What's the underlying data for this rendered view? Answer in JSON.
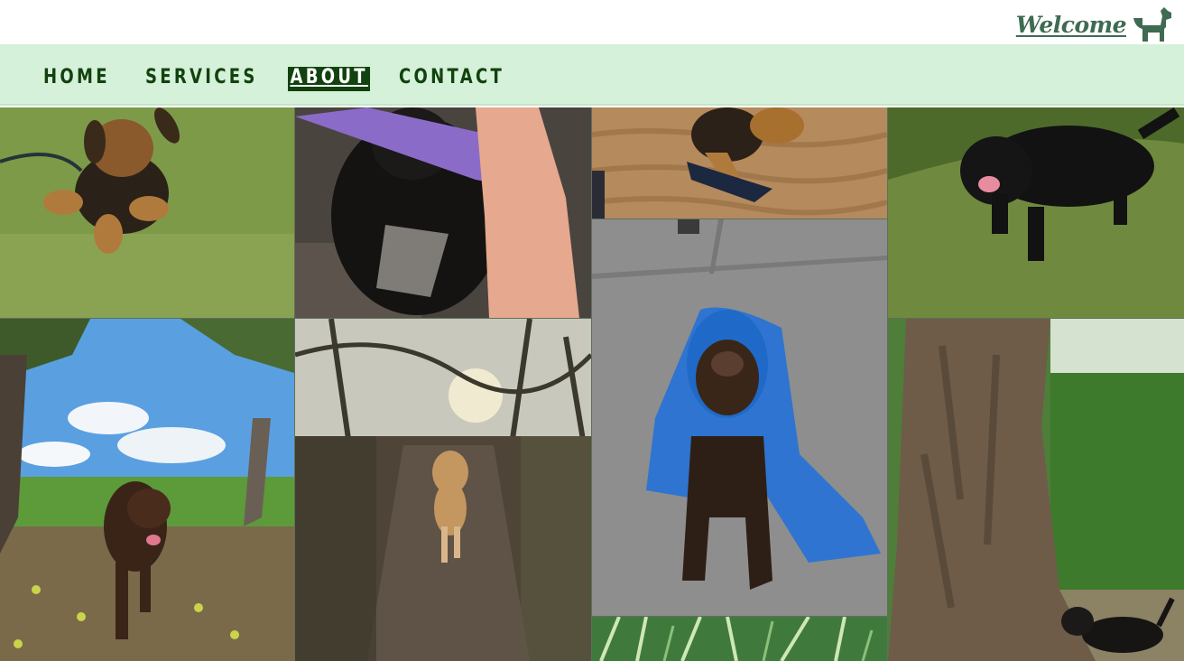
{
  "header": {
    "welcome_label": "Welcome",
    "logo_icon": "dog-icon",
    "accent_color": "#3f6b52"
  },
  "nav": {
    "background": "#d6f1d9",
    "text_color": "#12420f",
    "items": [
      {
        "label": "HOME",
        "active": false
      },
      {
        "label": "SERVICES",
        "active": false
      },
      {
        "label": "ABOUT",
        "active": true
      },
      {
        "label": "CONTACT",
        "active": false
      }
    ]
  },
  "gallery": {
    "photos": [
      {
        "name": "photo-terrier-puppy-grass"
      },
      {
        "name": "photo-black-dog-purple-toy"
      },
      {
        "name": "photo-terrier-beach-sand"
      },
      {
        "name": "photo-black-labrador-grass"
      },
      {
        "name": "photo-brown-spaniel-orchard"
      },
      {
        "name": "photo-tan-dog-woodland-path"
      },
      {
        "name": "photo-spaniel-blue-towel"
      },
      {
        "name": "photo-dachshund-by-tree"
      },
      {
        "name": "photo-willow-leaves"
      }
    ]
  }
}
